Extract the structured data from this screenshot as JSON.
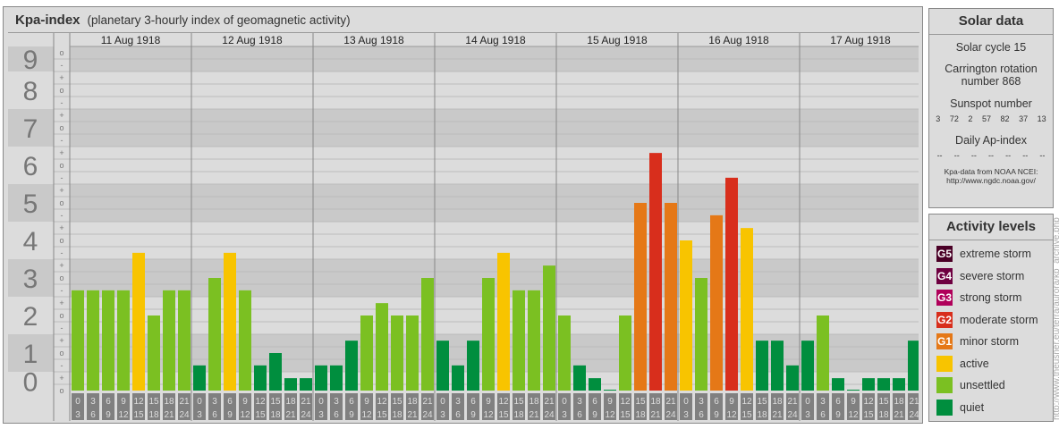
{
  "header": {
    "title": "Kpa-index",
    "subtitle": "(planetary 3-hourly index of geomagnetic activity)"
  },
  "chart_data": {
    "type": "bar",
    "title": "Kpa-index",
    "ylim": [
      0,
      9
    ],
    "y_ticks": [
      "0",
      "1",
      "2",
      "3",
      "4",
      "5",
      "6",
      "7",
      "8",
      "9"
    ],
    "sub_ticks": [
      "-",
      "o",
      "+"
    ],
    "days": [
      "11 Aug 1918",
      "12 Aug 1918",
      "13 Aug 1918",
      "14 Aug 1918",
      "15 Aug 1918",
      "16 Aug 1918",
      "17 Aug 1918"
    ],
    "intervals": [
      [
        "0",
        "3"
      ],
      [
        "3",
        "6"
      ],
      [
        "6",
        "9"
      ],
      [
        "9",
        "12"
      ],
      [
        "12",
        "15"
      ],
      [
        "15",
        "18"
      ],
      [
        "18",
        "21"
      ],
      [
        "21",
        "24"
      ]
    ],
    "values": [
      [
        2.67,
        2.67,
        2.67,
        2.67,
        3.67,
        2.0,
        2.67,
        2.67
      ],
      [
        0.67,
        3.0,
        3.67,
        2.67,
        0.67,
        1.0,
        0.33,
        0.33
      ],
      [
        0.67,
        0.67,
        1.33,
        2.0,
        2.33,
        2.0,
        2.0,
        3.0
      ],
      [
        1.33,
        0.67,
        1.33,
        3.0,
        3.67,
        2.67,
        2.67,
        3.33
      ],
      [
        2.0,
        0.67,
        0.33,
        0.0,
        2.0,
        5.0,
        6.33,
        5.0
      ],
      [
        4.0,
        3.0,
        4.67,
        5.67,
        4.33,
        1.33,
        1.33,
        0.67
      ],
      [
        1.33,
        2.0,
        0.33,
        0.0,
        0.33,
        0.33,
        0.33,
        1.33
      ]
    ],
    "grid": true
  },
  "colors": {
    "quiet": "#008e3e",
    "unsettled": "#7bc022",
    "active": "#f8c400",
    "G1": "#e57817",
    "G2": "#d82e1c",
    "G3": "#b0005a",
    "G4": "#6e0040",
    "G5": "#4a0026"
  },
  "solar": {
    "title": "Solar data",
    "cycle": "Solar cycle 15",
    "carrington": "Carrington rotation number 868",
    "sunspot_label": "Sunspot number",
    "sunspots": [
      "3",
      "72",
      "2",
      "57",
      "82",
      "37",
      "13"
    ],
    "ap_label": "Daily Ap-index",
    "ap": [
      "--",
      "--",
      "--",
      "--",
      "--",
      "--",
      "--"
    ],
    "source1": "Kpa-data from NOAA NCEI:",
    "source2": "http://www.ngdc.noaa.gov/"
  },
  "legend": {
    "title": "Activity levels",
    "items": [
      {
        "badge": "G5",
        "label": "extreme storm",
        "color": "#4a0026"
      },
      {
        "badge": "G4",
        "label": "severe storm",
        "color": "#6e0040"
      },
      {
        "badge": "G3",
        "label": "strong storm",
        "color": "#b0005a"
      },
      {
        "badge": "G2",
        "label": "moderate storm",
        "color": "#d82e1c"
      },
      {
        "badge": "G1",
        "label": "minor storm",
        "color": "#e57817"
      },
      {
        "badge": "",
        "label": "active",
        "color": "#f8c400"
      },
      {
        "badge": "",
        "label": "unsettled",
        "color": "#7bc022"
      },
      {
        "badge": "",
        "label": "quiet",
        "color": "#008e3e"
      }
    ]
  },
  "watermark": "http://www.theusner.eu/terra/aurora/kp_archive.php"
}
